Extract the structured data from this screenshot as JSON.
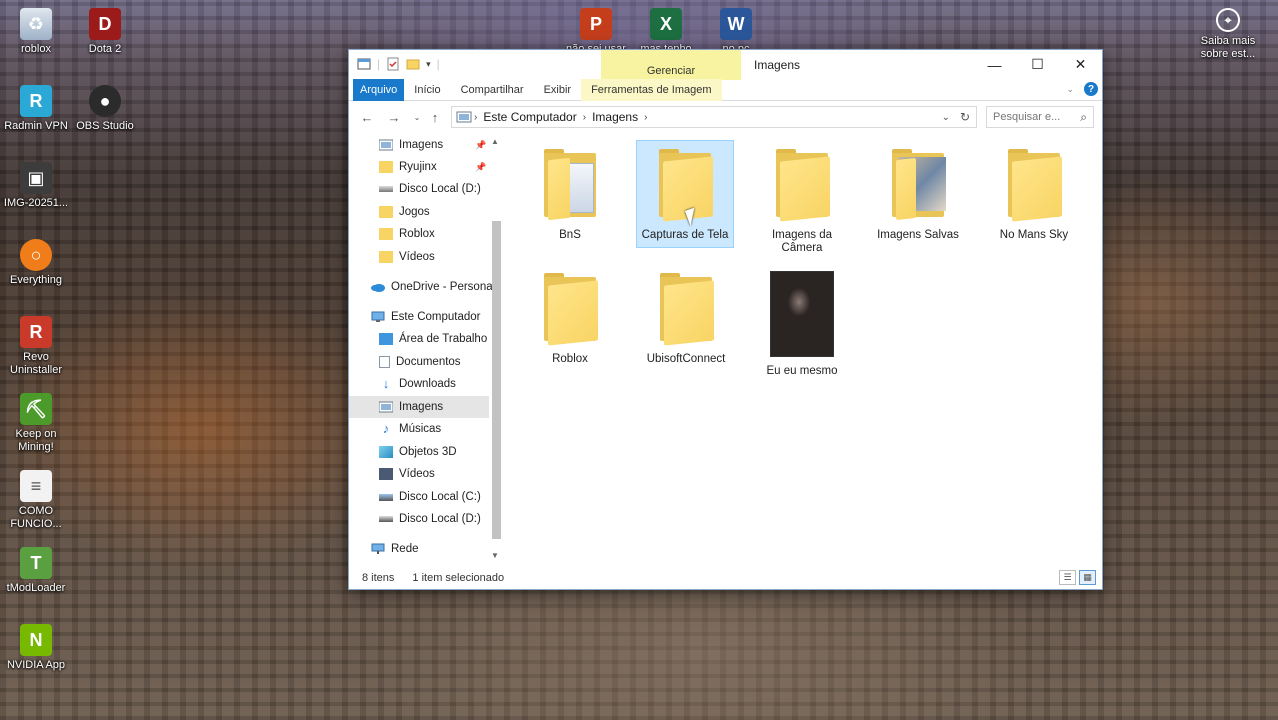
{
  "desktop": {
    "icons": [
      {
        "label": "roblox",
        "icon": "recycle-bin-icon"
      },
      {
        "label": "Dota 2",
        "icon": "dota-icon"
      },
      {
        "label": "Radmin VPN",
        "icon": "radmin-icon"
      },
      {
        "label": "OBS Studio",
        "icon": "obs-icon"
      },
      {
        "label": "IMG-20251...",
        "icon": "image-file-icon"
      },
      {
        "label": "Everything",
        "icon": "everything-icon"
      },
      {
        "label": "Revo Uninstaller",
        "icon": "revo-icon"
      },
      {
        "label": "Keep on Mining!",
        "icon": "keep-on-mining-icon"
      },
      {
        "label": "COMO FUNCIO...",
        "icon": "text-file-icon"
      },
      {
        "label": "tModLoader",
        "icon": "tmodloader-icon"
      },
      {
        "label": "NVIDIA App",
        "icon": "nvidia-icon"
      },
      {
        "label": "não sei usar",
        "icon": "powerpoint-icon"
      },
      {
        "label": "mas tenho",
        "icon": "excel-icon"
      },
      {
        "label": "no pc",
        "icon": "word-icon"
      },
      {
        "label": "Saiba mais sobre est...",
        "icon": "learn-more-icon"
      }
    ]
  },
  "window": {
    "title": "Imagens",
    "context_tab_header": "Gerenciar",
    "ribbon_tabs": [
      {
        "label": "Arquivo"
      },
      {
        "label": "Início"
      },
      {
        "label": "Compartilhar"
      },
      {
        "label": "Exibir"
      },
      {
        "label": "Ferramentas de Imagem"
      }
    ],
    "controls": {
      "minimize": "—",
      "maximize": "☐",
      "close": "✕"
    }
  },
  "address": {
    "crumbs": [
      "Este Computador",
      "Imagens"
    ],
    "search_placeholder": "Pesquisar e..."
  },
  "navpane": {
    "quick_access": [
      {
        "label": "Imagens",
        "icon": "pictures-icon",
        "pinned": true
      },
      {
        "label": "Ryujinx",
        "icon": "folder-icon",
        "pinned": true
      },
      {
        "label": "Disco Local (D:)",
        "icon": "drive-icon",
        "pinned": false
      },
      {
        "label": "Jogos",
        "icon": "folder-icon",
        "pinned": false
      },
      {
        "label": "Roblox",
        "icon": "folder-icon",
        "pinned": false
      },
      {
        "label": "Vídeos",
        "icon": "folder-icon",
        "pinned": false
      }
    ],
    "onedrive": "OneDrive - Persona",
    "this_pc": "Este Computador",
    "this_pc_items": [
      {
        "label": "Área de Trabalho",
        "icon": "desktop-icon"
      },
      {
        "label": "Documentos",
        "icon": "documents-icon"
      },
      {
        "label": "Downloads",
        "icon": "downloads-icon"
      },
      {
        "label": "Imagens",
        "icon": "pictures-icon",
        "selected": true
      },
      {
        "label": "Músicas",
        "icon": "music-icon"
      },
      {
        "label": "Objetos 3D",
        "icon": "3d-objects-icon"
      },
      {
        "label": "Vídeos",
        "icon": "videos-icon"
      },
      {
        "label": "Disco Local (C:)",
        "icon": "drive-icon"
      },
      {
        "label": "Disco Local (D:)",
        "icon": "drive-icon"
      }
    ],
    "network": "Rede"
  },
  "files": [
    {
      "label": "BnS",
      "kind": "folder-doc"
    },
    {
      "label": "Capturas de Tela",
      "kind": "folder",
      "selected": true
    },
    {
      "label": "Imagens da Câmera",
      "kind": "folder"
    },
    {
      "label": "Imagens Salvas",
      "kind": "folder-photo"
    },
    {
      "label": "No Mans Sky",
      "kind": "folder"
    },
    {
      "label": "Roblox",
      "kind": "folder"
    },
    {
      "label": "UbisoftConnect",
      "kind": "folder"
    },
    {
      "label": "Eu eu mesmo",
      "kind": "photo"
    }
  ],
  "status": {
    "count": "8 itens",
    "selection": "1 item selecionado"
  },
  "colors": {
    "accent": "#1979ca",
    "selection": "#cce8ff",
    "folder": "#f8d464",
    "context_tab": "#f8f3a0"
  }
}
